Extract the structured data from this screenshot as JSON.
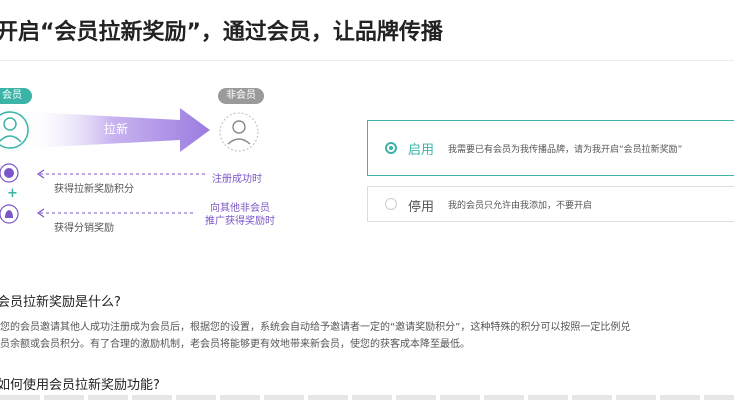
{
  "page": {
    "title": "开启“会员拉新奖励”，通过会员，让品牌传播"
  },
  "diagram": {
    "member_tag": "会员",
    "nonmember_tag": "非会员",
    "arrow_label": "拉新",
    "registered_label": "注册成功时",
    "invite_label_1": "向其他非会员",
    "invite_label_2": "推广获得奖励时",
    "gain_points_label": "获得拉新奖励积分",
    "gain_distribution_label": "获得分销奖励",
    "plus_sign": "+",
    "colors": {
      "member": "#3bb3a6",
      "nonmember": "#9a9a9a",
      "arrow": "#9b7be0",
      "accent_text": "#7b56c8"
    },
    "icons": [
      "member-avatar-icon",
      "nonmember-avatar-icon",
      "points-coin-icon",
      "money-bag-icon"
    ]
  },
  "options": {
    "enable": {
      "label": "启用",
      "description": "我需要已有会员为我传播品牌，请为我开启“会员拉新奖励”",
      "selected": true
    },
    "disable": {
      "label": "停用",
      "description": "我的会员只允许由我添加，不要开启",
      "selected": false
    },
    "accent_color": "#3bb3a6"
  },
  "faq": {
    "q1": "会员拉新奖励是什么?",
    "a1_line1": "您的会员邀请其他人成功注册成为会员后，根据您的设置，系统会自动给予邀请者一定的“邀请奖励积分”，这种特殊的积分可以按照一定比例兑",
    "a1_line2": "员余额或会员积分。有了合理的激励机制，老会员将能够更有效地带来新会员，使您的获客成本降至最低。",
    "q2": "如何使用会员拉新奖励功能?"
  }
}
